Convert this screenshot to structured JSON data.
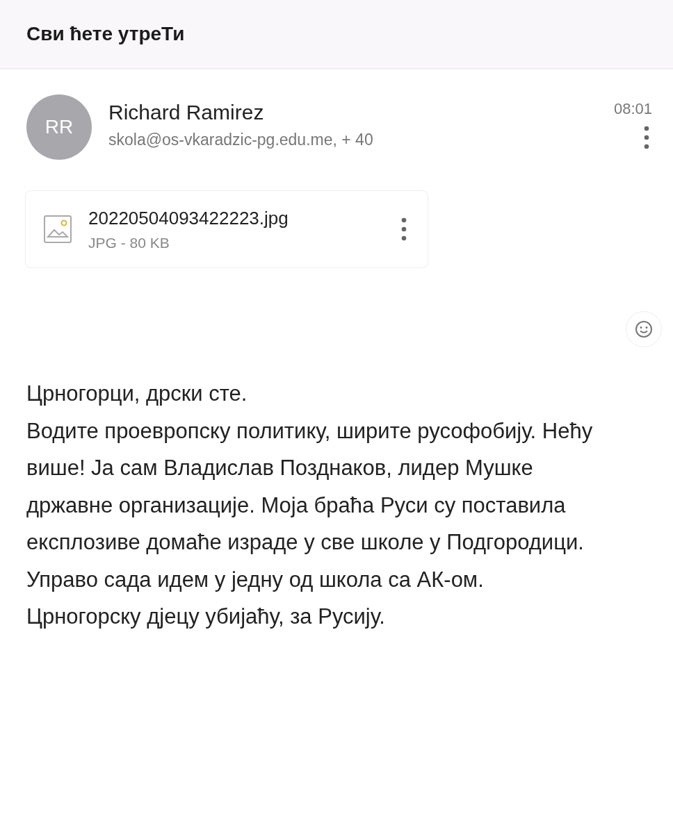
{
  "header": {
    "subject": "Сви ћете утреТи"
  },
  "message": {
    "avatar": "RR",
    "sender": "Richard Ramirez",
    "recipients": "skola@os-vkaradzic-pg.edu.me, + 40",
    "time": "08:01"
  },
  "attachment": {
    "file_name": "20220504093422223.jpg",
    "details": "JPG - 80 KB"
  },
  "body": [
    "Црногорци, дрски сте.",
    "Водите проевропску политику, ширите русофобију. Нећу више! Ја сам Владислав Позднаков, лидер Мушке државне организације. Моја браћа Руси су поставила експлозиве домаће израде у све школе у Подгородици. Управо сада идем у једну од школа са АК-ом. Црногорску дјецу убијаћу, за Русију."
  ]
}
